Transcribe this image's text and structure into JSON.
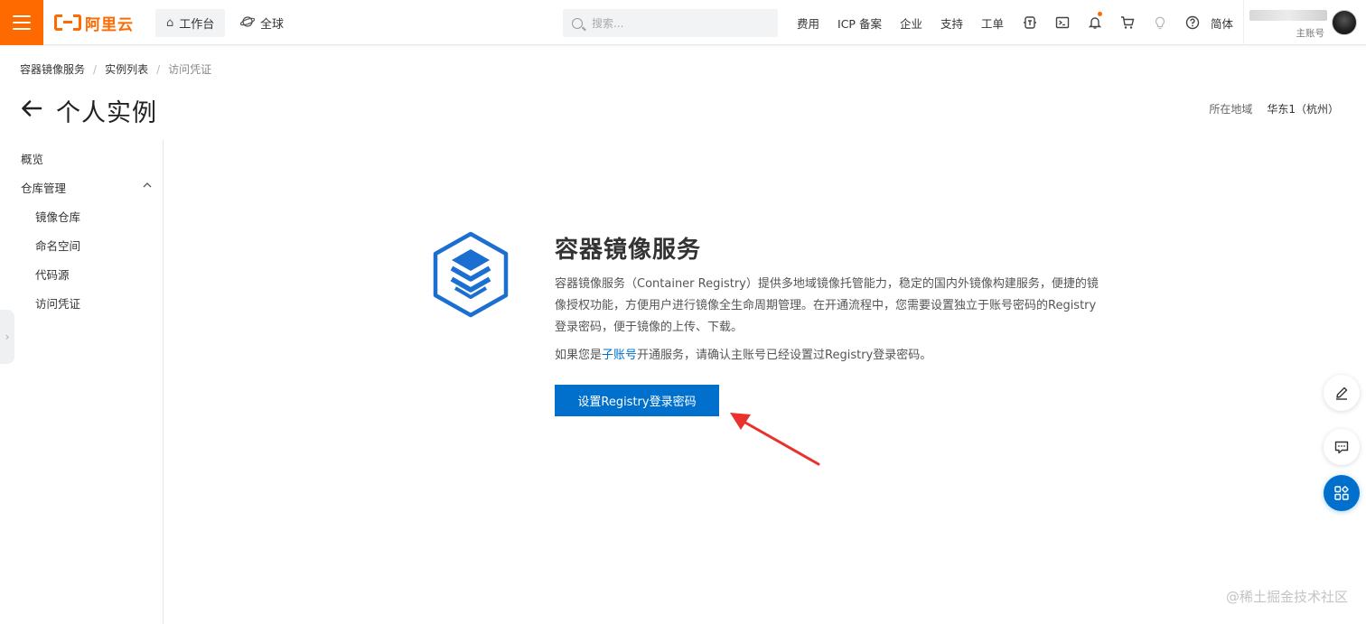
{
  "topbar": {
    "logo_text": "阿里云",
    "workbench_label": "工作台",
    "global_label": "全球",
    "search_placeholder": "搜索...",
    "links": [
      "费用",
      "ICP 备案",
      "企业",
      "支持",
      "工单"
    ],
    "language": "简体",
    "account_role": "主账号",
    "icons": [
      "ai-assistant-icon",
      "terminal-icon",
      "bell-icon",
      "cart-icon",
      "lightbulb-icon",
      "help-icon"
    ]
  },
  "breadcrumb": [
    "容器镜像服务",
    "实例列表",
    "访问凭证"
  ],
  "page": {
    "title": "个人实例",
    "region_label": "所在地域",
    "region_value": "华东1（杭州）"
  },
  "sidebar": {
    "overview": "概览",
    "repo_group": "仓库管理",
    "items": [
      "镜像仓库",
      "命名空间",
      "代码源",
      "访问凭证"
    ]
  },
  "main": {
    "service_title": "容器镜像服务",
    "description": "容器镜像服务（Container Registry）提供多地域镜像托管能力，稳定的国内外镜像构建服务，便捷的镜像授权功能，方便用户进行镜像全生命周期管理。在开通流程中，您需要设置独立于账号密码的Registry登录密码，便于镜像的上传、下载。",
    "note_prefix": "如果您是",
    "note_link": "子账号",
    "note_suffix": "开通服务，请确认主账号已经设置过Registry登录密码。",
    "button_label": "设置Registry登录密码"
  },
  "watermark": "@稀土掘金技术社区",
  "colors": {
    "brand": "#ff6a00",
    "primary": "#0070cc",
    "annotation": "#e8322b"
  }
}
